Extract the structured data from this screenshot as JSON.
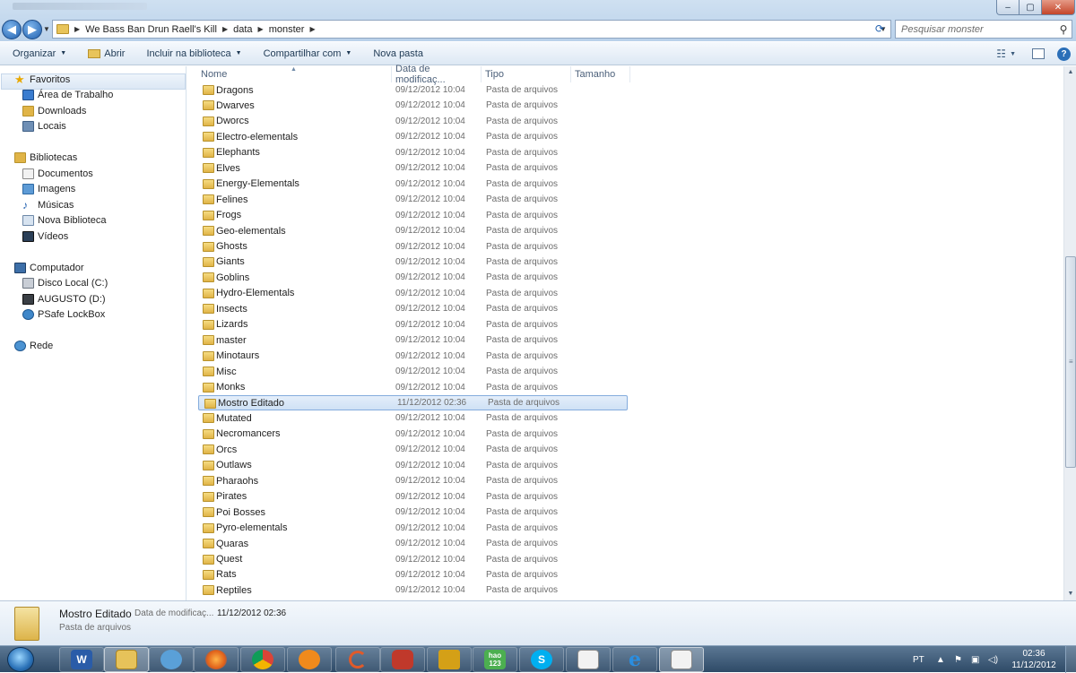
{
  "window": {
    "search_placeholder": "Pesquisar monster",
    "minimize": "‒",
    "maximize": "▢",
    "close": "✕"
  },
  "breadcrumb": [
    "We Bass Ban Drun Raell's Kill",
    "data",
    "monster"
  ],
  "toolbar": {
    "organize": "Organizar",
    "open": "Abrir",
    "include_library": "Incluir na biblioteca",
    "share_with": "Compartilhar com",
    "new_folder": "Nova pasta"
  },
  "nav": {
    "favorites": "Favoritos",
    "desktop": "Área de Trabalho",
    "downloads": "Downloads",
    "places": "Locais",
    "libraries": "Bibliotecas",
    "documents": "Documentos",
    "images": "Imagens",
    "music": "Músicas",
    "new_library": "Nova Biblioteca",
    "videos": "Vídeos",
    "computer": "Computador",
    "local_disk": "Disco Local (C:)",
    "augusto_drive": "AUGUSTO (D:)",
    "psafe": "PSafe LockBox",
    "network": "Rede"
  },
  "columns": {
    "name": "Nome",
    "date": "Data de modificaç...",
    "type": "Tipo",
    "size": "Tamanho"
  },
  "files": [
    {
      "name": "Dragons",
      "date": "09/12/2012 10:04",
      "type": "Pasta de arquivos"
    },
    {
      "name": "Dwarves",
      "date": "09/12/2012 10:04",
      "type": "Pasta de arquivos"
    },
    {
      "name": "Dworcs",
      "date": "09/12/2012 10:04",
      "type": "Pasta de arquivos"
    },
    {
      "name": "Electro-elementals",
      "date": "09/12/2012 10:04",
      "type": "Pasta de arquivos"
    },
    {
      "name": "Elephants",
      "date": "09/12/2012 10:04",
      "type": "Pasta de arquivos"
    },
    {
      "name": "Elves",
      "date": "09/12/2012 10:04",
      "type": "Pasta de arquivos"
    },
    {
      "name": "Energy-Elementals",
      "date": "09/12/2012 10:04",
      "type": "Pasta de arquivos"
    },
    {
      "name": "Felines",
      "date": "09/12/2012 10:04",
      "type": "Pasta de arquivos"
    },
    {
      "name": "Frogs",
      "date": "09/12/2012 10:04",
      "type": "Pasta de arquivos"
    },
    {
      "name": "Geo-elementals",
      "date": "09/12/2012 10:04",
      "type": "Pasta de arquivos"
    },
    {
      "name": "Ghosts",
      "date": "09/12/2012 10:04",
      "type": "Pasta de arquivos"
    },
    {
      "name": "Giants",
      "date": "09/12/2012 10:04",
      "type": "Pasta de arquivos"
    },
    {
      "name": "Goblins",
      "date": "09/12/2012 10:04",
      "type": "Pasta de arquivos"
    },
    {
      "name": "Hydro-Elementals",
      "date": "09/12/2012 10:04",
      "type": "Pasta de arquivos"
    },
    {
      "name": "Insects",
      "date": "09/12/2012 10:04",
      "type": "Pasta de arquivos"
    },
    {
      "name": "Lizards",
      "date": "09/12/2012 10:04",
      "type": "Pasta de arquivos"
    },
    {
      "name": "master",
      "date": "09/12/2012 10:04",
      "type": "Pasta de arquivos"
    },
    {
      "name": "Minotaurs",
      "date": "09/12/2012 10:04",
      "type": "Pasta de arquivos"
    },
    {
      "name": "Misc",
      "date": "09/12/2012 10:04",
      "type": "Pasta de arquivos"
    },
    {
      "name": "Monks",
      "date": "09/12/2012 10:04",
      "type": "Pasta de arquivos"
    },
    {
      "name": "Mostro Editado",
      "date": "11/12/2012 02:36",
      "type": "Pasta de arquivos",
      "selected": true
    },
    {
      "name": "Mutated",
      "date": "09/12/2012 10:04",
      "type": "Pasta de arquivos"
    },
    {
      "name": "Necromancers",
      "date": "09/12/2012 10:04",
      "type": "Pasta de arquivos"
    },
    {
      "name": "Orcs",
      "date": "09/12/2012 10:04",
      "type": "Pasta de arquivos"
    },
    {
      "name": "Outlaws",
      "date": "09/12/2012 10:04",
      "type": "Pasta de arquivos"
    },
    {
      "name": "Pharaohs",
      "date": "09/12/2012 10:04",
      "type": "Pasta de arquivos"
    },
    {
      "name": "Pirates",
      "date": "09/12/2012 10:04",
      "type": "Pasta de arquivos"
    },
    {
      "name": "Poi Bosses",
      "date": "09/12/2012 10:04",
      "type": "Pasta de arquivos"
    },
    {
      "name": "Pyro-elementals",
      "date": "09/12/2012 10:04",
      "type": "Pasta de arquivos"
    },
    {
      "name": "Quaras",
      "date": "09/12/2012 10:04",
      "type": "Pasta de arquivos"
    },
    {
      "name": "Quest",
      "date": "09/12/2012 10:04",
      "type": "Pasta de arquivos"
    },
    {
      "name": "Rats",
      "date": "09/12/2012 10:04",
      "type": "Pasta de arquivos"
    },
    {
      "name": "Reptiles",
      "date": "09/12/2012 10:04",
      "type": "Pasta de arquivos"
    }
  ],
  "details": {
    "name": "Mostro Editado",
    "date_label": "Data de modificaç...",
    "date_value": "11/12/2012 02:36",
    "type": "Pasta de arquivos"
  },
  "taskbar": {
    "language": "PT",
    "time": "02:36",
    "date": "11/12/2012",
    "apps": [
      "word-icon",
      "explorer-icon",
      "network-tool-icon",
      "firefox-icon",
      "chrome-icon",
      "avast-icon",
      "loading-app-icon",
      "game-character-icon",
      "game-avatar-icon",
      "hao123-icon",
      "skype-icon",
      "paint-icon",
      "internet-explorer-icon",
      "paint-active-icon"
    ],
    "labels": {
      "word": "W",
      "hao123": "hao 123",
      "skype": "S",
      "ie": "e"
    }
  },
  "colors": {
    "selection_border": "#84acdd",
    "folder_yellow": "#e0b447",
    "taskbar": "#2e4a67"
  }
}
